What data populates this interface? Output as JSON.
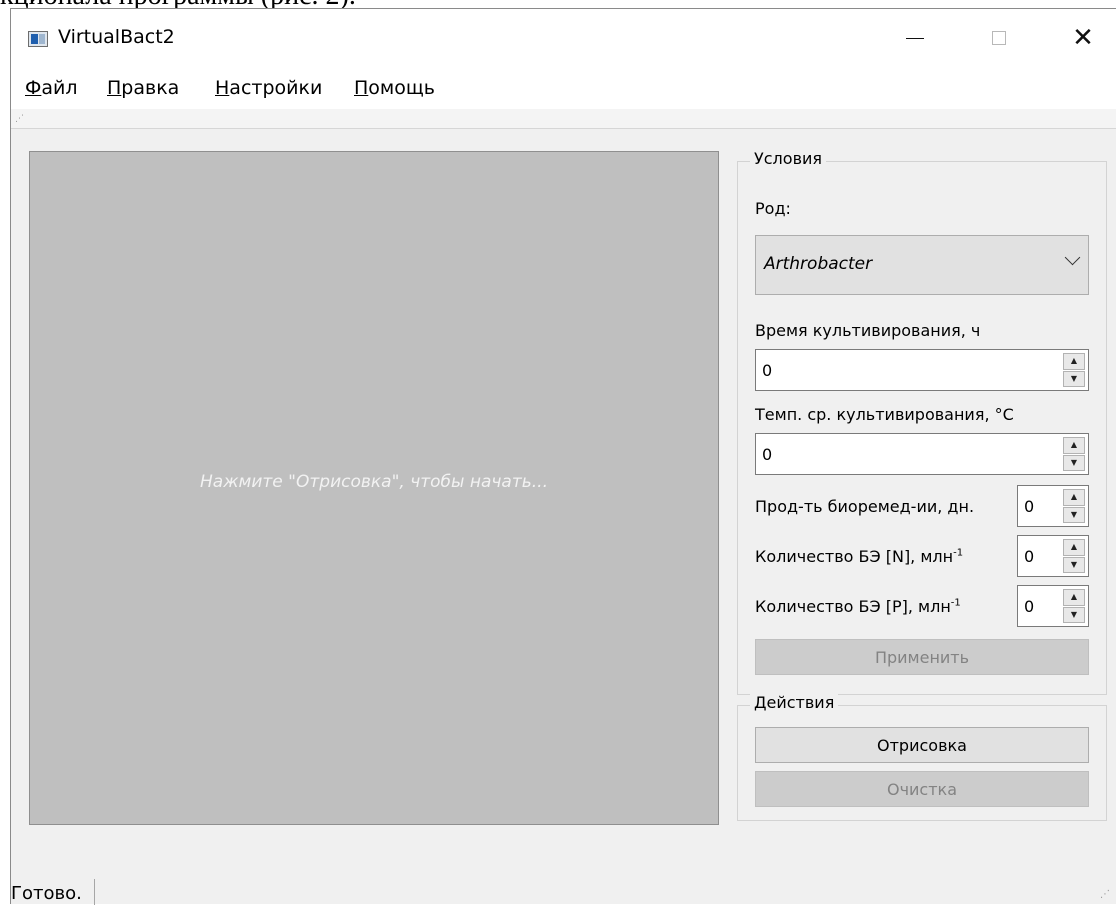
{
  "document": {
    "fragment_text": "кционала программы (рис. 2)."
  },
  "window": {
    "title": "VirtualBact2",
    "controls": {
      "minimize": "—",
      "maximize": "□",
      "close": "✕"
    }
  },
  "menu": {
    "items": [
      {
        "accel": "Ф",
        "rest": "айл"
      },
      {
        "accel": "П",
        "rest": "равка"
      },
      {
        "accel": "Н",
        "rest": "астройки"
      },
      {
        "accel": "П",
        "rest": "омощь"
      }
    ]
  },
  "canvas": {
    "hint": "Нажмите \"Отрисовка\", чтобы начать..."
  },
  "conditions": {
    "title": "Условия",
    "genus_label": "Род:",
    "genus_value": "Arthrobacter",
    "cultivation_time_label": "Время культивирования, ч",
    "cultivation_time_value": "0",
    "cultivation_temp_label": "Темп. ср. культивирования, °С",
    "cultivation_temp_value": "0",
    "bioremediation_label": "Прод-ть биоремед-ии, дн.",
    "bioremediation_value": "0",
    "be_n_label": "Количество БЭ [N], млн",
    "be_n_sup": "-1",
    "be_n_value": "0",
    "be_p_label": "Количество БЭ [P], млн",
    "be_p_sup": "-1",
    "be_p_value": "0",
    "apply_label": "Применить"
  },
  "actions": {
    "title": "Действия",
    "draw_label": "Отрисовка",
    "clear_label": "Очистка"
  },
  "status": {
    "text": "Готово."
  }
}
